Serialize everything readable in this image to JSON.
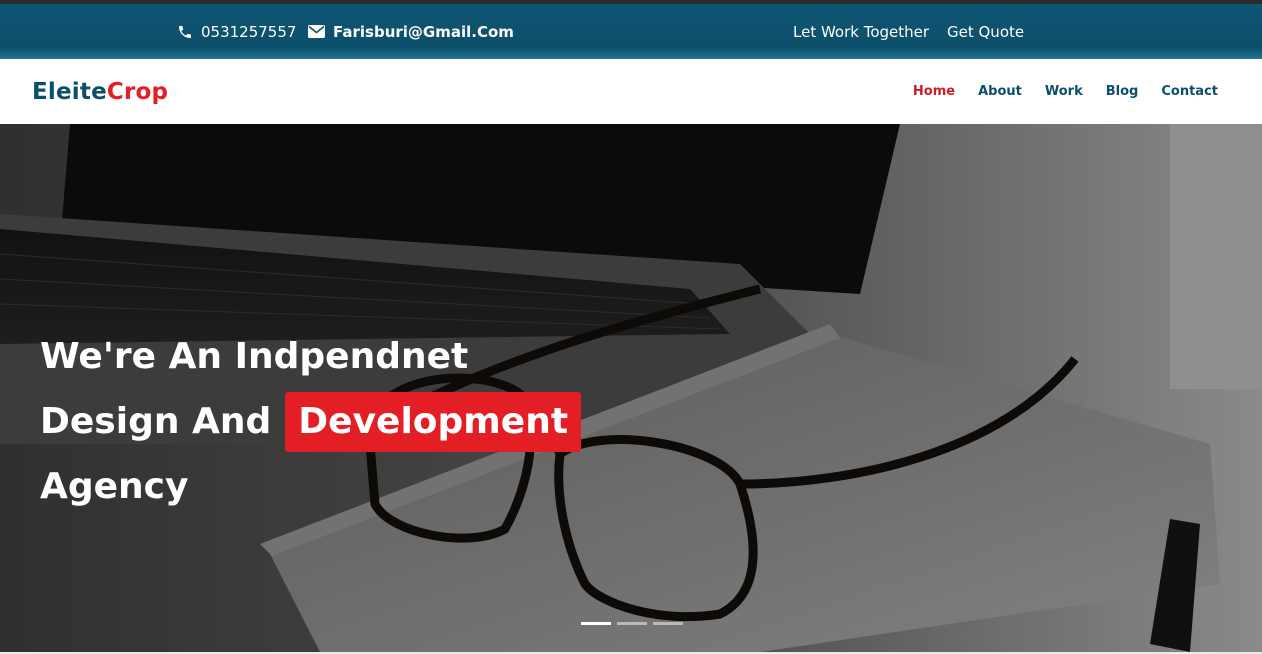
{
  "topbar": {
    "phone": "0531257557",
    "email": "Farisburi@Gmail.Com",
    "links": {
      "together": "Let Work Together",
      "quote": "Get Quote"
    },
    "icons": {
      "phone": "phone-icon",
      "email": "envelope-icon"
    }
  },
  "brand": {
    "part1": "Eleite",
    "part2": "Crop"
  },
  "nav": {
    "items": [
      {
        "label": "Home",
        "active": true
      },
      {
        "label": "About"
      },
      {
        "label": "Work"
      },
      {
        "label": "Blog"
      },
      {
        "label": "Contact"
      }
    ]
  },
  "hero": {
    "line1": "We're An Indpendnet",
    "line2": "Design And",
    "highlight": "Development",
    "line3": "Agency",
    "slides": 3,
    "active_slide": 1
  },
  "colors": {
    "primary": "#0c4f6b",
    "accent": "#e31e24",
    "nav_active": "#c91d22"
  }
}
